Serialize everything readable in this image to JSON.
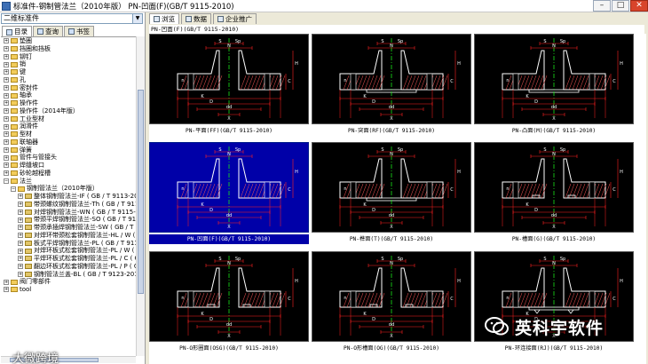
{
  "window": {
    "title": "标准件-钢制管法兰（2010年版）  PN-凹面(F)(GB/T 9115-2010)",
    "minimize": "–",
    "maximize": "□",
    "close": "✕"
  },
  "left": {
    "filter_value": "二维标准件",
    "tabs": [
      {
        "label": "目录"
      },
      {
        "label": "查询"
      },
      {
        "label": "书签"
      }
    ],
    "tree": [
      {
        "label": "垫圈",
        "expander": "+",
        "depth": 0,
        "kind": "folder"
      },
      {
        "label": "挡圈和挡板",
        "expander": "+",
        "depth": 0,
        "kind": "folder"
      },
      {
        "label": "铆钉",
        "expander": "+",
        "depth": 0,
        "kind": "folder"
      },
      {
        "label": "销",
        "expander": "+",
        "depth": 0,
        "kind": "folder"
      },
      {
        "label": "键",
        "expander": "+",
        "depth": 0,
        "kind": "folder"
      },
      {
        "label": "孔",
        "expander": "+",
        "depth": 0,
        "kind": "folder"
      },
      {
        "label": "密封件",
        "expander": "+",
        "depth": 0,
        "kind": "folder"
      },
      {
        "label": "轴承",
        "expander": "+",
        "depth": 0,
        "kind": "folder"
      },
      {
        "label": "操作件",
        "expander": "+",
        "depth": 0,
        "kind": "folder"
      },
      {
        "label": "操作件（2014年版）",
        "expander": "+",
        "depth": 0,
        "kind": "folder"
      },
      {
        "label": "工业型材",
        "expander": "+",
        "depth": 0,
        "kind": "folder"
      },
      {
        "label": "润滑件",
        "expander": "+",
        "depth": 0,
        "kind": "folder"
      },
      {
        "label": "型材",
        "expander": "+",
        "depth": 0,
        "kind": "folder"
      },
      {
        "label": "联轴器",
        "expander": "+",
        "depth": 0,
        "kind": "folder"
      },
      {
        "label": "弹簧",
        "expander": "+",
        "depth": 0,
        "kind": "folder"
      },
      {
        "label": "管件与管接头",
        "expander": "+",
        "depth": 0,
        "kind": "folder"
      },
      {
        "label": "焊缝坡口",
        "expander": "+",
        "depth": 0,
        "kind": "folder"
      },
      {
        "label": "砂轮越程槽",
        "expander": "+",
        "depth": 0,
        "kind": "folder"
      },
      {
        "label": "法兰",
        "expander": "−",
        "depth": 0,
        "kind": "folder"
      },
      {
        "label": "钢制管法兰（2010年版）",
        "expander": "−",
        "depth": 1,
        "kind": "folder"
      },
      {
        "label": "整体钢制管法兰-IF ( GB / T 9113-2010 )",
        "expander": "+",
        "depth": 2,
        "kind": "doc"
      },
      {
        "label": "带颈螺纹钢制管法兰-Th ( GB / T 9114-2",
        "expander": "+",
        "depth": 2,
        "kind": "doc"
      },
      {
        "label": "对焊钢制管法兰-WN ( GB / T 9115-2010",
        "expander": "+",
        "depth": 2,
        "kind": "doc"
      },
      {
        "label": "带颈平焊钢制管法兰-SO ( GB / T 9116-2",
        "expander": "+",
        "depth": 2,
        "kind": "doc"
      },
      {
        "label": "带颈承插焊钢制管法兰-SW ( GB / T 911",
        "expander": "+",
        "depth": 2,
        "kind": "doc"
      },
      {
        "label": "对焊环带颈松套钢制管法兰-HL / W ( GB",
        "expander": "+",
        "depth": 2,
        "kind": "doc"
      },
      {
        "label": "板式平焊钢制管法兰-PL ( GB / T 9119-20",
        "expander": "+",
        "depth": 2,
        "kind": "doc"
      },
      {
        "label": "对焊环板式松套钢制管法兰-PL / W ( GB",
        "expander": "+",
        "depth": 2,
        "kind": "doc"
      },
      {
        "label": "平焊环板式松套钢制管法兰-PL / C ( GB /",
        "expander": "+",
        "depth": 2,
        "kind": "doc"
      },
      {
        "label": "翻边环板式松套钢制管法兰-PL / P ( GB /",
        "expander": "+",
        "depth": 2,
        "kind": "doc"
      },
      {
        "label": "钢制管法兰盖-BL ( GB / T 9123-2010 )",
        "expander": "+",
        "depth": 2,
        "kind": "doc"
      },
      {
        "label": "阀门零部件",
        "expander": "+",
        "depth": 0,
        "kind": "folder"
      },
      {
        "label": "tool",
        "expander": "+",
        "depth": 0,
        "kind": "folder"
      }
    ]
  },
  "right": {
    "tabs": [
      {
        "label": "浏览"
      },
      {
        "label": "数据"
      },
      {
        "label": "企业推广"
      }
    ],
    "breadcrumb": "PN-凹面(F)(GB/T 9115-2010)",
    "items": [
      {
        "caption": "PN-平面(FF)(GB/T 9115-2010)",
        "variant": "ff",
        "selected": false
      },
      {
        "caption": "PN-突面(RF)(GB/T 9115-2010)",
        "variant": "rf",
        "selected": false
      },
      {
        "caption": "PN-凸面(M)(GB/T 9115-2010)",
        "variant": "m",
        "selected": false
      },
      {
        "caption": "PN-凹面(F)(GB/T 9115-2010)",
        "variant": "f",
        "selected": true
      },
      {
        "caption": "PN-榫面(T)(GB/T 9115-2010)",
        "variant": "t",
        "selected": false
      },
      {
        "caption": "PN-槽面(G)(GB/T 9115-2010)",
        "variant": "g",
        "selected": false
      },
      {
        "caption": "PN-O形圈面(OSG)(GB/T 9115-2010)",
        "variant": "osg",
        "selected": false
      },
      {
        "caption": "PN-O形槽面(OG)(GB/T 9115-2010)",
        "variant": "og",
        "selected": false
      },
      {
        "caption": "PN-环连接面(RJ)(GB/T 9115-2010)",
        "variant": "rj",
        "selected": false
      }
    ],
    "dim_labels": {
      "k": "K",
      "d": "D",
      "n": "n",
      "c": "C",
      "s": "S",
      "sp": "Sp",
      "n_small": "N",
      "h": "H",
      "x": "X",
      "dd": "dd"
    }
  },
  "watermark": {
    "brand": "英科宇软件",
    "overlay": "大微跨境"
  },
  "colors": {
    "cad_background": "#000000",
    "cad_selected_background": "#0000a8",
    "part_outline": "#ffffff",
    "dimension_lines": "#ff2020",
    "centerline": "#19e619",
    "hatch": "#ff5a5a"
  }
}
